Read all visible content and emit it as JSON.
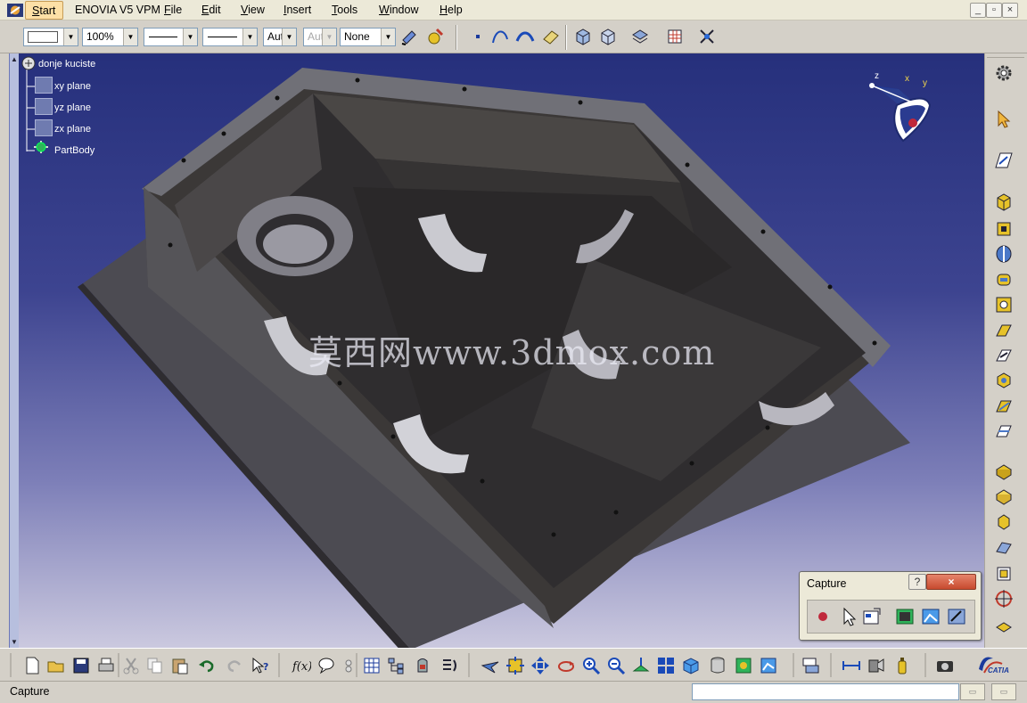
{
  "menubar": {
    "items": [
      {
        "label": "Start",
        "key": "S"
      },
      {
        "label": "ENOVIA V5 VPM",
        "key": ""
      },
      {
        "label": "File",
        "key": "F"
      },
      {
        "label": "Edit",
        "key": "E"
      },
      {
        "label": "View",
        "key": "V"
      },
      {
        "label": "Insert",
        "key": "I"
      },
      {
        "label": "Tools",
        "key": "T"
      },
      {
        "label": "Window",
        "key": "W"
      },
      {
        "label": "Help",
        "key": "H"
      }
    ],
    "window_buttons": [
      "_",
      "▫",
      "×"
    ]
  },
  "toolbar": {
    "zoom_value": "100%",
    "font_value": "Aut",
    "font_value_disabled": "Aut",
    "layer_value": "None"
  },
  "tree": {
    "root": "donje kuciste",
    "children": [
      "xy plane",
      "yz plane",
      "zx plane"
    ],
    "part_body": "PartBody"
  },
  "compass": {
    "x_label": "x",
    "y_label": "y",
    "z_label": "z"
  },
  "watermark": {
    "text": "莫西网www.3dmox.com"
  },
  "capture_dialog": {
    "title": "Capture",
    "help_label": "?",
    "close_label": "×"
  },
  "status": {
    "text": "Capture",
    "command_value": ""
  },
  "branding": {
    "label": "CATIA"
  },
  "colors": {
    "viewport_top": "#26307c",
    "viewport_bottom": "#cbc9df",
    "model_dark": "#3a3736",
    "model_light": "#77767c",
    "start_highlight": "#fde0a6"
  },
  "icons": {
    "top": [
      "fill-color-dropdown",
      "line-thickness-dropdown",
      "line-type-dropdown",
      "painter-icon",
      "apply-material-icon",
      "point-icon",
      "curve-icon",
      "surface-icon",
      "measure-icon",
      "view-icon",
      "view-mode-icon",
      "hide-show-icon",
      "swap-icon",
      "snap-icon"
    ],
    "right": [
      "gear-icon",
      "select-arrow-icon",
      "sketcher-icon",
      "pad-icon",
      "pocket-icon",
      "shaft-icon",
      "groove-icon",
      "hole-icon",
      "rib-icon",
      "slot-icon",
      "stiffener-icon",
      "solid-combine-icon",
      "multi-sections-icon",
      "fillet-icon",
      "chamfer-icon",
      "draft-icon",
      "shell-icon",
      "thickness-icon",
      "thread-icon",
      "mirror-icon",
      "pattern-icon"
    ],
    "bottom": [
      "new-icon",
      "open-icon",
      "save-icon",
      "print-icon",
      "cut-icon",
      "copy-icon",
      "paste-icon",
      "undo-icon",
      "redo-icon",
      "whats-this-icon",
      "formula-icon",
      "knowledge-icon",
      "table-icon",
      "tree-icon",
      "catalog-icon",
      "macro-icon",
      "fly-mode-icon",
      "fit-all-icon",
      "pan-icon",
      "rotate-icon",
      "zoom-in-icon",
      "zoom-out-icon",
      "normal-view-icon",
      "multi-view-icon",
      "iso-view-icon",
      "render-icon",
      "shading-icon",
      "display-icon",
      "measure-between-icon",
      "analysis-icon",
      "mass-icon",
      "camera-icon"
    ],
    "capture": [
      "record-icon",
      "select-icon",
      "options-icon",
      "capture-icon",
      "image-icon",
      "album-icon"
    ]
  }
}
